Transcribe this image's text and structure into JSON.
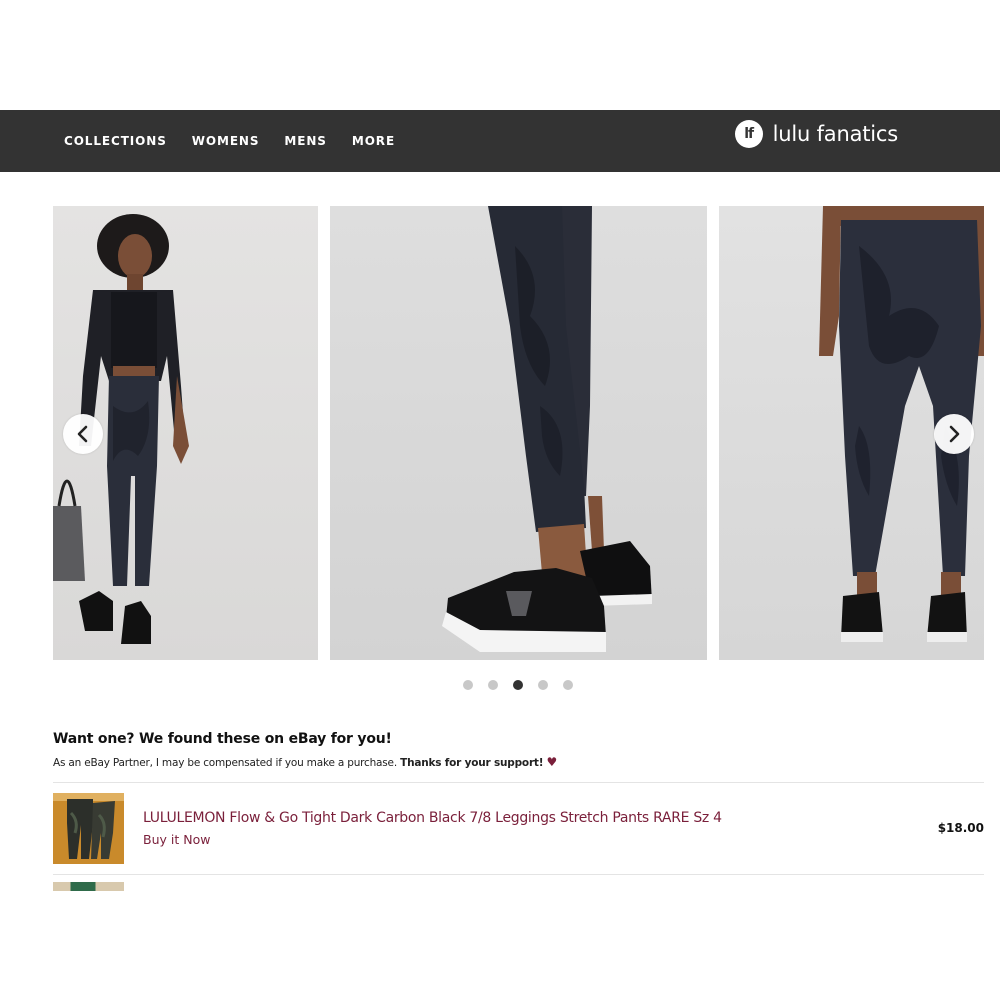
{
  "nav": {
    "items": [
      "COLLECTIONS",
      "WOMENS",
      "MENS",
      "MORE"
    ],
    "brand_logo": "lf",
    "brand_name": "lulu fanatics"
  },
  "carousel": {
    "slide_count": 5,
    "active_index": 2,
    "prev_icon": "chevron-left-icon",
    "next_icon": "chevron-right-icon"
  },
  "ebay": {
    "heading": "Want one? We found these on eBay for you!",
    "disclaimer_prefix": "As an eBay Partner, I may be compensated if you make a purchase.",
    "disclaimer_thanks": "Thanks for your support!",
    "heart_icon": "heart-icon",
    "listings": [
      {
        "title": "LULULEMON Flow & Go Tight Dark Carbon Black 7/8 Leggings Stretch Pants RARE Sz 4",
        "buy_label": "Buy it Now",
        "price": "$18.00"
      }
    ]
  },
  "colors": {
    "nav_bg": "#333333",
    "accent": "#7a1f3a",
    "dot_active": "#333333",
    "dot_inactive": "#c8c8c8"
  }
}
